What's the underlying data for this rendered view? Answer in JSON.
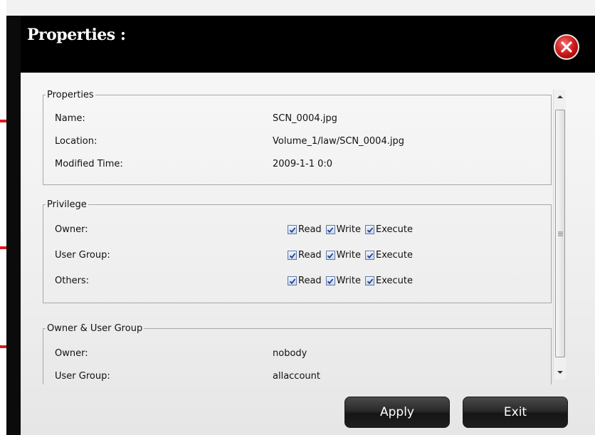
{
  "dialog": {
    "title": "Properties :",
    "close_icon": "close-icon"
  },
  "properties": {
    "legend": "Properties",
    "rows": [
      {
        "label": "Name:",
        "value": "SCN_0004.jpg"
      },
      {
        "label": "Location:",
        "value": "Volume_1/law/SCN_0004.jpg"
      },
      {
        "label": "Modified Time:",
        "value": "2009-1-1 0:0"
      }
    ]
  },
  "privilege": {
    "legend": "Privilege",
    "perm_labels": {
      "read": "Read",
      "write": "Write",
      "execute": "Execute"
    },
    "rows": [
      {
        "label": "Owner:",
        "read": true,
        "write": true,
        "execute": true
      },
      {
        "label": "User Group:",
        "read": true,
        "write": true,
        "execute": true
      },
      {
        "label": "Others:",
        "read": true,
        "write": true,
        "execute": true
      }
    ]
  },
  "owner_group": {
    "legend": "Owner & User Group",
    "rows": [
      {
        "label": "Owner:",
        "value": "nobody"
      },
      {
        "label": "User Group:",
        "value": "allaccount"
      }
    ]
  },
  "buttons": {
    "apply": "Apply",
    "exit": "Exit"
  },
  "colors": {
    "annotation_arrow": "#e0181e",
    "title_bar": "#000000",
    "close_button": "#c91414"
  }
}
